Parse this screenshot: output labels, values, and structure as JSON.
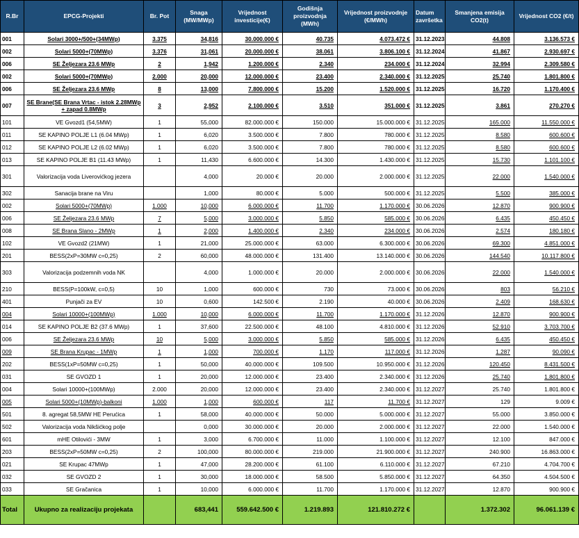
{
  "headers": [
    "R.Br",
    "EPCG-Projekti",
    "Br. Pot",
    "Snaga (MW/MWp)",
    "Vrijednost investicije(€)",
    "Godišnja proizvodnja (MWh)",
    "Vrijednost proizvodnje (€/MWh)",
    "Datum završetka",
    "Smanjena emisija CO2(t)",
    "Vrijednost CO2 (€/t)"
  ],
  "rows": [
    {
      "rbr": "001",
      "name": "Solari 3000+/500+(34MWp)",
      "pot": "3.375",
      "snaga": "34,816",
      "inv": "30.000.000 €",
      "proiz": "40.735",
      "vrij": "4.073.472 €",
      "datum": "31.12.2023",
      "co2": "44.808",
      "co2v": "3.136.573 €",
      "bold": true,
      "u": [
        1,
        2,
        3,
        4,
        5,
        6,
        8,
        9
      ]
    },
    {
      "rbr": "002",
      "name": "Solari 5000+(70MWp)",
      "pot": "3.376",
      "snaga": "31,061",
      "inv": "20.000.000 €",
      "proiz": "38.061",
      "vrij": "3.806.100 €",
      "datum": "31.12.2024",
      "co2": "41.867",
      "co2v": "2.930.697 €",
      "bold": true,
      "u": [
        1,
        2,
        3,
        4,
        5,
        6,
        8,
        9
      ]
    },
    {
      "rbr": "006",
      "name": "SE Željezara 23.6 MWp",
      "pot": "2",
      "snaga": "1,942",
      "inv": "1.200.000 €",
      "proiz": "2.340",
      "vrij": "234.000 €",
      "datum": "31.12.2024",
      "co2": "32.994",
      "co2v": "2.309.580 €",
      "bold": true,
      "u": [
        1,
        2,
        3,
        4,
        5,
        6,
        8,
        9
      ]
    },
    {
      "rbr": "002",
      "name": "Solari 5000+(70MWp)",
      "pot": "2.000",
      "snaga": "20,000",
      "inv": "12.000.000 €",
      "proiz": "23.400",
      "vrij": "2.340.000 €",
      "datum": "31.12.2025",
      "co2": "25.740",
      "co2v": "1.801.800 €",
      "bold": true,
      "u": [
        1,
        2,
        3,
        4,
        5,
        6,
        8,
        9
      ]
    },
    {
      "rbr": "006",
      "name": "SE Željezara 23.6 MWp",
      "pot": "8",
      "snaga": "13,000",
      "inv": "7.800.000 €",
      "proiz": "15.200",
      "vrij": "1.520.000 €",
      "datum": "31.12.2025",
      "co2": "16.720",
      "co2v": "1.170.400 €",
      "bold": true,
      "u": [
        1,
        2,
        3,
        4,
        5,
        6,
        8,
        9
      ]
    },
    {
      "rbr": "007",
      "name": "SE Brane(SE Brana Vrtac - istok 2.28MWp + zapad 0.8MWp",
      "pot": "3",
      "snaga": "2,952",
      "inv": "2.100.000 €",
      "proiz": "3.510",
      "vrij": "351.000 €",
      "datum": "31.12.2025",
      "co2": "3.861",
      "co2v": "270.270 €",
      "bold": true,
      "tall": true,
      "u": [
        1,
        2,
        3,
        4,
        5,
        6,
        8,
        9
      ]
    },
    {
      "rbr": "101",
      "name": "VE Gvozd1 (54,5MW)",
      "pot": "1",
      "snaga": "55,000",
      "inv": "82.000.000 €",
      "proiz": "150.000",
      "vrij": "15.000.000 €",
      "datum": "31.12.2025",
      "co2": "165.000",
      "co2v": "11.550.000 €",
      "bold": false,
      "u": [
        8,
        9
      ]
    },
    {
      "rbr": "011",
      "name": "SE KAPINO POLJE L1  (6.04 MWp)",
      "pot": "1",
      "snaga": "6,020",
      "inv": "3.500.000 €",
      "proiz": "7.800",
      "vrij": "780.000 €",
      "datum": "31.12.2025",
      "co2": "8.580",
      "co2v": "600.600 €",
      "bold": false,
      "u": [
        8,
        9
      ]
    },
    {
      "rbr": "012",
      "name": "SE KAPINO POLJE L2  (6.02 MWp)",
      "pot": "1",
      "snaga": "6,020",
      "inv": "3.500.000 €",
      "proiz": "7.800",
      "vrij": "780.000 €",
      "datum": "31.12.2025",
      "co2": "8.580",
      "co2v": "600.600 €",
      "bold": false,
      "u": [
        8,
        9
      ]
    },
    {
      "rbr": "013",
      "name": "SE KAPINO POLJE B1  (11.43 MWp)",
      "pot": "1",
      "snaga": "11,430",
      "inv": "6.600.000 €",
      "proiz": "14.300",
      "vrij": "1.430.000 €",
      "datum": "31.12.2025",
      "co2": "15.730",
      "co2v": "1.101.100 €",
      "bold": false,
      "u": [
        8,
        9
      ]
    },
    {
      "rbr": "301",
      "name": "Valorizacija voda Liverovićkog jezera",
      "pot": "",
      "snaga": "4,000",
      "inv": "20.000 €",
      "proiz": "20.000",
      "vrij": "2.000.000 €",
      "datum": "31.12.2025",
      "co2": "22.000",
      "co2v": "1.540.000 €",
      "bold": false,
      "tall": true,
      "u": [
        8,
        9
      ]
    },
    {
      "rbr": "302",
      "name": "Sanacija brane na Viru",
      "pot": "",
      "snaga": "1,000",
      "inv": "80.000 €",
      "proiz": "5.000",
      "vrij": "500.000 €",
      "datum": "31.12.2025",
      "co2": "5.500",
      "co2v": "385.000 €",
      "bold": false,
      "u": [
        8,
        9
      ]
    },
    {
      "rbr": "002",
      "name": "Solari 5000+(70MWp)",
      "pot": "1.000",
      "snaga": "10,000",
      "inv": "6.000.000 €",
      "proiz": "11.700",
      "vrij": "1.170.000 €",
      "datum": "30.06.2026",
      "co2": "12.870",
      "co2v": "900.900 €",
      "bold": false,
      "u": [
        1,
        2,
        3,
        4,
        5,
        6,
        8,
        9
      ]
    },
    {
      "rbr": "006",
      "name": "SE Željezara 23.6 MWp",
      "pot": "7",
      "snaga": "5,000",
      "inv": "3.000.000 €",
      "proiz": "5.850",
      "vrij": "585.000 €",
      "datum": "30.06.2026",
      "co2": "6.435",
      "co2v": "450.450 €",
      "bold": false,
      "u": [
        1,
        2,
        3,
        4,
        5,
        6,
        8,
        9
      ]
    },
    {
      "rbr": "008",
      "name": "SE Brana Slano -  2MWp",
      "pot": "1",
      "snaga": "2,000",
      "inv": "1.400.000 €",
      "proiz": "2.340",
      "vrij": "234.000 €",
      "datum": "30.06.2026",
      "co2": "2.574",
      "co2v": "180.180 €",
      "bold": false,
      "u": [
        1,
        2,
        3,
        4,
        5,
        6,
        8,
        9
      ]
    },
    {
      "rbr": "102",
      "name": "VE Gvozd2 (21MW)",
      "pot": "1",
      "snaga": "21,000",
      "inv": "25.000.000 €",
      "proiz": "63.000",
      "vrij": "6.300.000 €",
      "datum": "30.06.2026",
      "co2": "69.300",
      "co2v": "4.851.000 €",
      "bold": false,
      "u": [
        8,
        9
      ]
    },
    {
      "rbr": "201",
      "name": "BESS(2xP=30MW c=0,25)",
      "pot": "2",
      "snaga": "60,000",
      "inv": "48.000.000 €",
      "proiz": "131.400",
      "vrij": "13.140.000 €",
      "datum": "30.06.2026",
      "co2": "144.540",
      "co2v": "10.117.800 €",
      "bold": false,
      "u": [
        8,
        9
      ]
    },
    {
      "rbr": "303",
      "name": "Valorizacija podzemnih voda NK",
      "pot": "",
      "snaga": "4,000",
      "inv": "1.000.000 €",
      "proiz": "20.000",
      "vrij": "2.000.000 €",
      "datum": "30.06.2026",
      "co2": "22.000",
      "co2v": "1.540.000 €",
      "bold": false,
      "tall": true,
      "u": [
        8,
        9
      ]
    },
    {
      "rbr": "210",
      "name": "BESS(P=100kW, c=0,5)",
      "pot": "10",
      "snaga": "1,000",
      "inv": "600.000 €",
      "proiz": "730",
      "vrij": "73.000 €",
      "datum": "30.06.2026",
      "co2": "803",
      "co2v": "56.210 €",
      "bold": false,
      "u": [
        8,
        9
      ]
    },
    {
      "rbr": "401",
      "name": "Punjači za EV",
      "pot": "10",
      "snaga": "0,600",
      "inv": "142.500 €",
      "proiz": "2.190",
      "vrij": "40.000 €",
      "datum": "30.06.2026",
      "co2": "2.409",
      "co2v": "168.630 €",
      "bold": false,
      "u": [
        8,
        9
      ]
    },
    {
      "rbr": "004",
      "name": "Solari 10000+(100MWp)",
      "pot": "1.000",
      "snaga": "10,000",
      "inv": "6.000.000 €",
      "proiz": "11.700",
      "vrij": "1.170.000 €",
      "datum": "31.12.2026",
      "co2": "12.870",
      "co2v": "900.900 €",
      "bold": false,
      "u": [
        0,
        1,
        2,
        3,
        4,
        5,
        6,
        8,
        9
      ]
    },
    {
      "rbr": "014",
      "name": "SE KAPINO POLJE B2  (37.6 MWp)",
      "pot": "1",
      "snaga": "37,600",
      "inv": "22.500.000 €",
      "proiz": "48.100",
      "vrij": "4.810.000 €",
      "datum": "31.12.2026",
      "co2": "52.910",
      "co2v": "3.703.700 €",
      "bold": false,
      "u": [
        8,
        9
      ]
    },
    {
      "rbr": "006",
      "name": "SE Željezara 23.6 MWp",
      "pot": "10",
      "snaga": "5,000",
      "inv": "3.000.000 €",
      "proiz": "5.850",
      "vrij": "585.000 €",
      "datum": "31.12.2026",
      "co2": "6.435",
      "co2v": "450.450 €",
      "bold": false,
      "u": [
        1,
        2,
        3,
        4,
        5,
        6,
        8,
        9
      ]
    },
    {
      "rbr": "009",
      "name": "SE Brana Krupac -  1MWp",
      "pot": "1",
      "snaga": "1,000",
      "inv": "700.000 €",
      "proiz": "1.170",
      "vrij": "117.000 €",
      "datum": "31.12.2026",
      "co2": "1.287",
      "co2v": "90.090 €",
      "bold": false,
      "u": [
        0,
        1,
        2,
        3,
        4,
        5,
        6,
        8,
        9
      ]
    },
    {
      "rbr": "202",
      "name": "BESS(1xP=50MW c=0,25)",
      "pot": "1",
      "snaga": "50,000",
      "inv": "40.000.000 €",
      "proiz": "109.500",
      "vrij": "10.950.000 €",
      "datum": "31.12.2026",
      "co2": "120.450",
      "co2v": "8.431.500 €",
      "bold": false,
      "u": [
        8,
        9
      ]
    },
    {
      "rbr": "031",
      "name": "SE GVOZD 1",
      "pot": "1",
      "snaga": "20,000",
      "inv": "12.000.000 €",
      "proiz": "23.400",
      "vrij": "2.340.000 €",
      "datum": "31.12.2026",
      "co2": "25.740",
      "co2v": "1.801.800 €",
      "bold": false,
      "u": [
        8,
        9
      ]
    },
    {
      "rbr": "004",
      "name": "Solari 10000+(100MWp)",
      "pot": "2.000",
      "snaga": "20,000",
      "inv": "12.000.000 €",
      "proiz": "23.400",
      "vrij": "2.340.000 €",
      "datum": "31.12.2027",
      "co2": "25.740",
      "co2v": "1.801.800 €",
      "bold": false,
      "u": []
    },
    {
      "rbr": "005",
      "name": "Solari 5000+(10MWp)-balkoni",
      "pot": "1.000",
      "snaga": "1,000",
      "inv": "600.000 €",
      "proiz": "117",
      "vrij": "11.700 €",
      "datum": "31.12.2027",
      "co2": "129",
      "co2v": "9.009 €",
      "bold": false,
      "u": [
        0,
        1,
        2,
        3,
        4,
        5,
        6
      ]
    },
    {
      "rbr": "501",
      "name": "8. agregat 58,5MW HE Perućica",
      "pot": "1",
      "snaga": "58,000",
      "inv": "40.000.000 €",
      "proiz": "50.000",
      "vrij": "5.000.000 €",
      "datum": "31.12.2027",
      "co2": "55.000",
      "co2v": "3.850.000 €",
      "bold": false,
      "u": []
    },
    {
      "rbr": "502",
      "name": "Valorizacija voda Nikšićkog polje",
      "pot": "",
      "snaga": "0,000",
      "inv": "30.000.000 €",
      "proiz": "20.000",
      "vrij": "2.000.000 €",
      "datum": "31.12.2027",
      "co2": "22.000",
      "co2v": "1.540.000 €",
      "bold": false,
      "u": []
    },
    {
      "rbr": "601",
      "name": "mHE Otilovići - 3MW",
      "pot": "1",
      "snaga": "3,000",
      "inv": "6.700.000 €",
      "proiz": "11.000",
      "vrij": "1.100.000 €",
      "datum": "31.12.2027",
      "co2": "12.100",
      "co2v": "847.000 €",
      "bold": false,
      "u": []
    },
    {
      "rbr": "203",
      "name": "BESS(2xP=50MW c=0,25)",
      "pot": "2",
      "snaga": "100,000",
      "inv": "80.000.000 €",
      "proiz": "219.000",
      "vrij": "21.900.000 €",
      "datum": "31.12.2027",
      "co2": "240.900",
      "co2v": "16.863.000 €",
      "bold": false,
      "u": []
    },
    {
      "rbr": "021",
      "name": "SE Krupac 47MWp",
      "pot": "1",
      "snaga": "47,000",
      "inv": "28.200.000 €",
      "proiz": "61.100",
      "vrij": "6.110.000 €",
      "datum": "31.12.2027",
      "co2": "67.210",
      "co2v": "4.704.700 €",
      "bold": false,
      "u": []
    },
    {
      "rbr": "032",
      "name": "SE GVOZD 2",
      "pot": "1",
      "snaga": "30,000",
      "inv": "18.000.000 €",
      "proiz": "58.500",
      "vrij": "5.850.000 €",
      "datum": "31.12.2027",
      "co2": "64.350",
      "co2v": "4.504.500 €",
      "bold": false,
      "u": []
    },
    {
      "rbr": "033",
      "name": "SE Gračanica",
      "pot": "1",
      "snaga": "10,000",
      "inv": "6.000.000 €",
      "proiz": "11.700",
      "vrij": "1.170.000 €",
      "datum": "31.12.2027",
      "co2": "12.870",
      "co2v": "900.900 €",
      "bold": false,
      "u": []
    }
  ],
  "total": {
    "label": "Total",
    "name": "Ukupno za realizaciju projekata",
    "snaga": "683,441",
    "inv": "559.642.500 €",
    "proiz": "1.219.893",
    "vrij": "121.810.272 €",
    "co2": "1.372.302",
    "co2v": "96.061.139 €"
  },
  "colors": {
    "header_bg": "#1f4e79",
    "header_text": "#ffffff",
    "total_bg": "#92d050"
  }
}
